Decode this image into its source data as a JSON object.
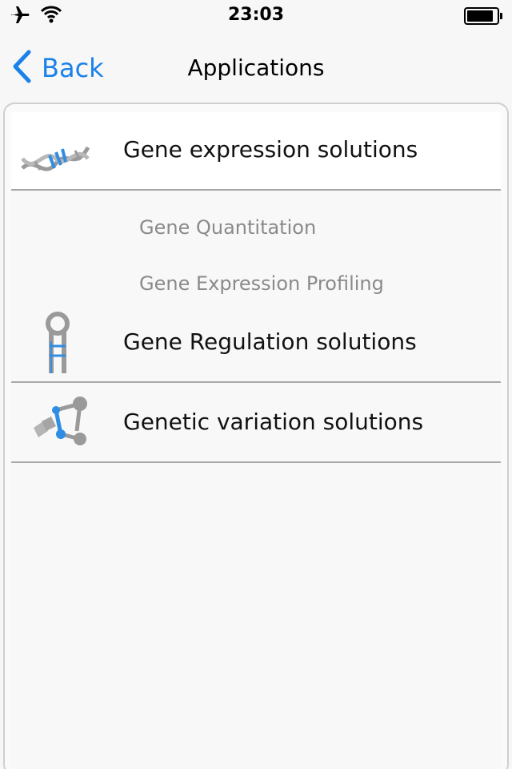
{
  "status_bar": {
    "time": "23:03",
    "icons": [
      "airplane-icon",
      "wifi-icon",
      "battery-icon"
    ],
    "battery_level": 0.9
  },
  "nav": {
    "back_label": "Back",
    "title": "Applications",
    "accent_color": "#1a82e8"
  },
  "sections": [
    {
      "title": "Gene expression solutions",
      "icon": "dna-helix-icon",
      "sub_items": [
        "Gene Quantitation",
        "Gene Expression Profiling"
      ]
    },
    {
      "title": "Gene Regulation solutions",
      "icon": "hairpin-rna-icon",
      "sub_items": []
    },
    {
      "title": "Genetic variation solutions",
      "icon": "molecule-variation-icon",
      "sub_items": []
    }
  ]
}
